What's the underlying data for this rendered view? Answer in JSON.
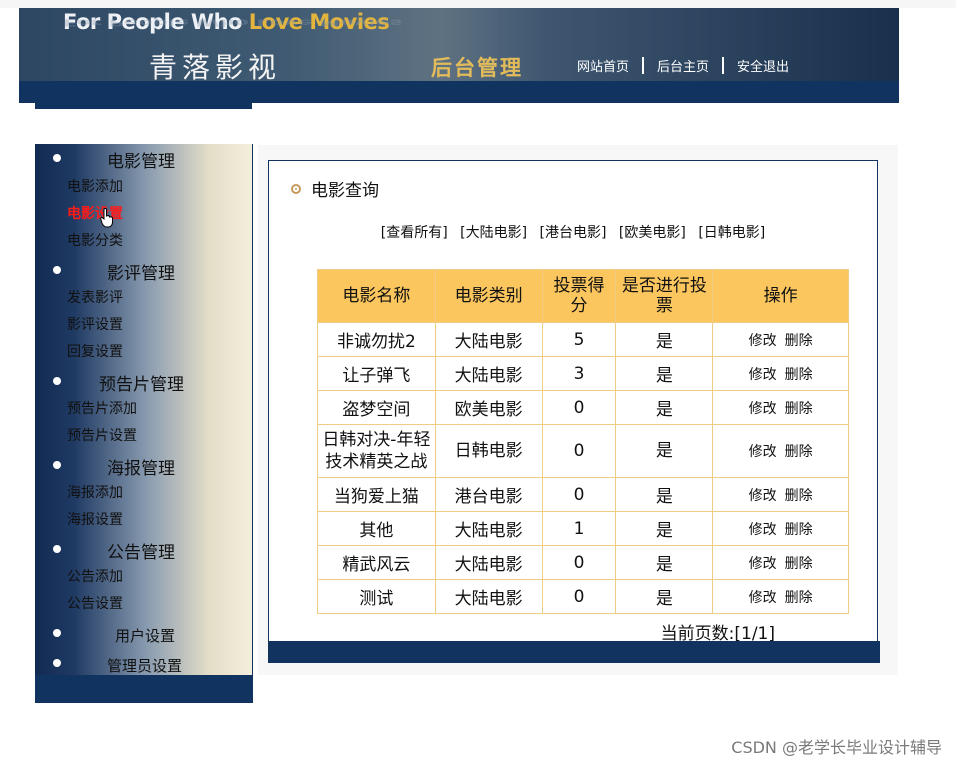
{
  "header": {
    "slogan_start": "For People Who ",
    "slogan_highlight": "Love Movies",
    "logo": "青落影视",
    "admin_title": "后台管理",
    "nav": [
      {
        "label": "网站首页"
      },
      {
        "label": "后台主页"
      },
      {
        "label": "安全退出"
      }
    ]
  },
  "sidebar": {
    "sections": [
      {
        "title": "电影管理",
        "items": [
          "电影添加",
          "电影设置",
          "电影分类"
        ]
      },
      {
        "title": "影评管理",
        "items": [
          "发表影评",
          "影评设置",
          "回复设置"
        ]
      },
      {
        "title": "预告片管理",
        "items": [
          "预告片添加",
          "预告片设置"
        ]
      },
      {
        "title": "海报管理",
        "items": [
          "海报添加",
          "海报设置"
        ]
      },
      {
        "title": "公告管理",
        "items": [
          "公告添加",
          "公告设置"
        ]
      },
      {
        "title": "用户设置",
        "items": []
      },
      {
        "title": "管理员设置",
        "items": []
      }
    ],
    "active_item": "电影设置"
  },
  "main": {
    "title": "电影查询",
    "filters": [
      "[查看所有]",
      "[大陆电影]",
      "[港台电影]",
      "[欧美电影]",
      "[日韩电影]"
    ],
    "table": {
      "headers": [
        "电影名称",
        "电影类别",
        "投票得分",
        "是否进行投票",
        "操作"
      ],
      "rows": [
        {
          "name": "非诚勿扰2",
          "category": "大陆电影",
          "score": "5",
          "vote": "是"
        },
        {
          "name": "让子弹飞",
          "category": "大陆电影",
          "score": "3",
          "vote": "是"
        },
        {
          "name": "盗梦空间",
          "category": "欧美电影",
          "score": "0",
          "vote": "是"
        },
        {
          "name": "日韩对决-年轻技术精英之战",
          "category": "日韩电影",
          "score": "0",
          "vote": "是"
        },
        {
          "name": "当狗爱上猫",
          "category": "港台电影",
          "score": "0",
          "vote": "是"
        },
        {
          "name": "其他",
          "category": "大陆电影",
          "score": "1",
          "vote": "是"
        },
        {
          "name": "精武风云",
          "category": "大陆电影",
          "score": "0",
          "vote": "是"
        },
        {
          "name": "测试",
          "category": "大陆电影",
          "score": "0",
          "vote": "是"
        }
      ],
      "edit_label": "修改",
      "delete_label": "删除"
    },
    "pager": "当前页数:[1/1]"
  },
  "watermark": "CSDN @老学长毕业设计辅导",
  "colors": {
    "navy": "#10345f",
    "table_header": "#fbc65e",
    "table_border": "#f0cc84",
    "active_link": "#ff1a1a",
    "gold": "#e2bb5a"
  }
}
